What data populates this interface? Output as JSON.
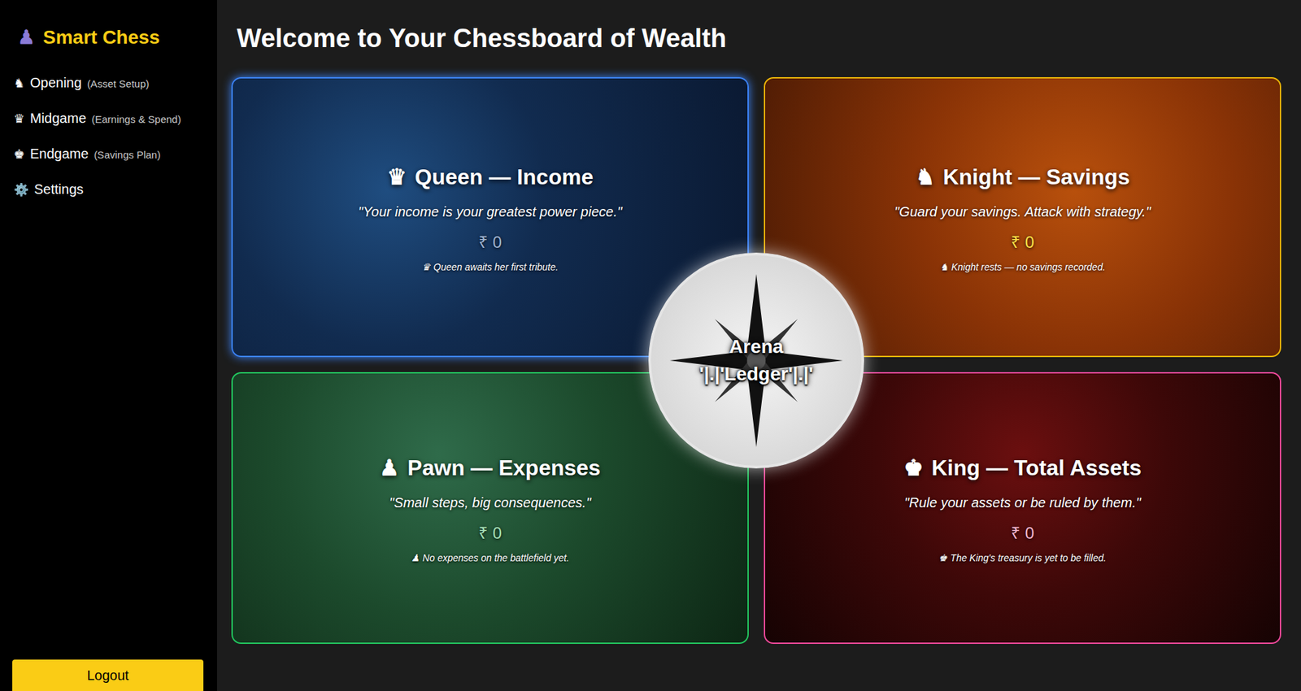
{
  "sidebar": {
    "brand_icon": "♟",
    "brand": "Smart Chess",
    "items": [
      {
        "icon": "♞",
        "label": "Opening",
        "sub": "(Asset Setup)"
      },
      {
        "icon": "♛",
        "label": "Midgame",
        "sub": "(Earnings & Spend)"
      },
      {
        "icon": "♚",
        "label": "Endgame",
        "sub": "(Savings Plan)"
      },
      {
        "icon": "⚙️",
        "label": "Settings",
        "sub": ""
      }
    ],
    "logout": "Logout"
  },
  "heading": "Welcome to Your Chessboard of Wealth",
  "cards": [
    {
      "icon": "♛",
      "title": "Queen — Income",
      "quote": "\"Your income is your greatest power piece.\"",
      "amount": "₹ 0",
      "note_icon": "♛",
      "note": "Queen awaits her first tribute.",
      "color": "#3b82f6",
      "amount_color": "#9fb3d1"
    },
    {
      "icon": "♞",
      "title": "Knight — Savings",
      "quote": "\"Guard your savings. Attack with strategy.\"",
      "amount": "₹ 0",
      "note_icon": "♞",
      "note": "Knight rests — no savings recorded.",
      "color": "#eab308",
      "amount_color": "#fde047"
    },
    {
      "icon": "♟",
      "title": "Pawn — Expenses",
      "quote": "\"Small steps, big consequences.\"",
      "amount": "₹ 0",
      "note_icon": "♟",
      "note": "No expenses on the battlefield yet.",
      "color": "#22c55e",
      "amount_color": "#a7e0b8"
    },
    {
      "icon": "♚",
      "title": "King — Total Assets",
      "quote": "\"Rule your assets or be ruled by them.\"",
      "amount": "₹ 0",
      "note_icon": "♚",
      "note": "The King's treasury is yet to be filled.",
      "color": "#ec4899",
      "amount_color": "#f4b6cf"
    }
  ],
  "center": {
    "lines": [
      "Arena",
      "'|.|'Ledger'|.|'"
    ]
  }
}
